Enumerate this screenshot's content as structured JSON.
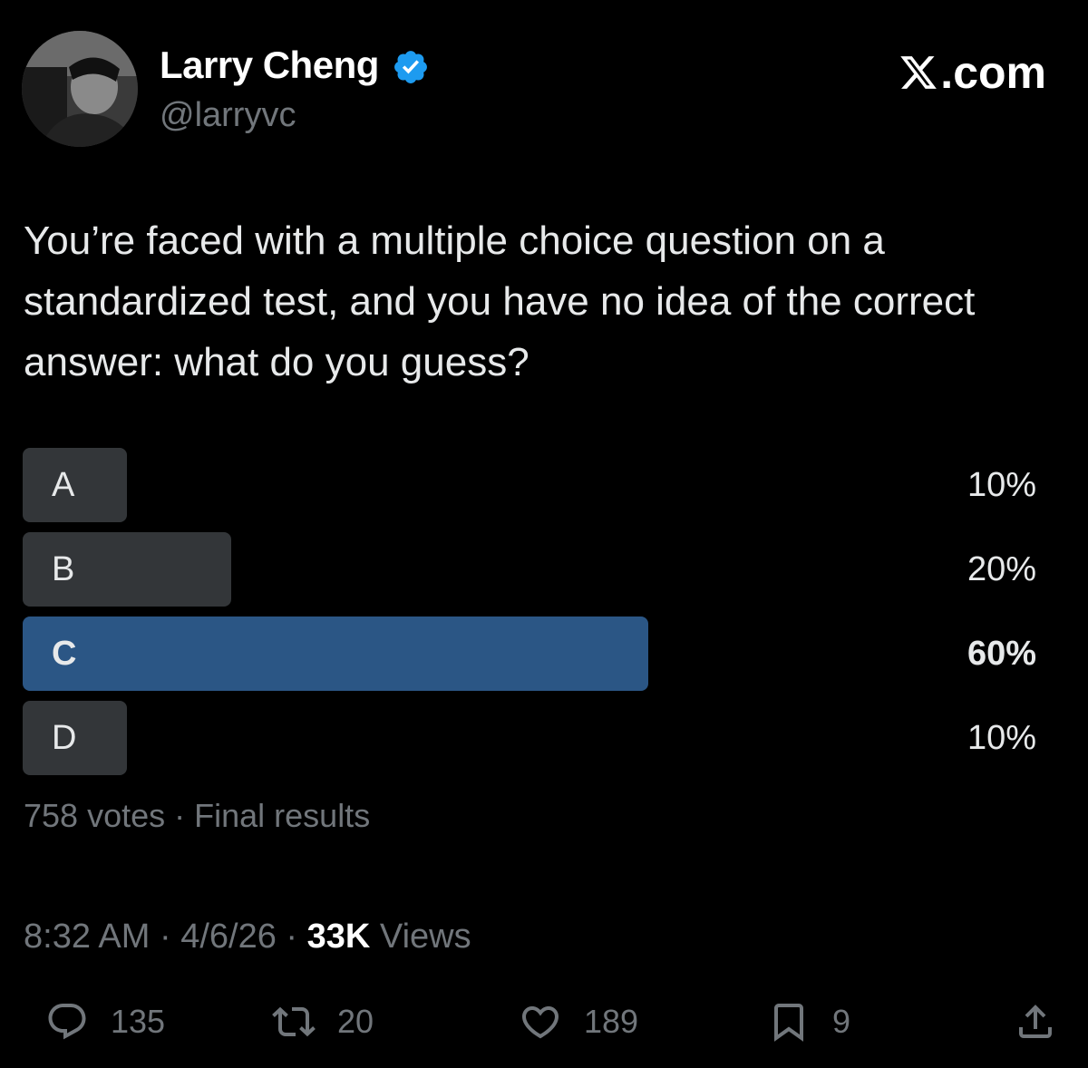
{
  "author": {
    "display_name": "Larry Cheng",
    "handle": "@larryvc",
    "verified": true
  },
  "brand": {
    "logo_icon": "x-logo-icon",
    "suffix": ".com"
  },
  "tweet": {
    "text": "You’re faced with a multiple choice question on a standardized test, and you have no idea of the correct answer: what do you guess?"
  },
  "poll": {
    "options": [
      {
        "label": "A",
        "percent": 10,
        "display": "10%",
        "winner": false
      },
      {
        "label": "B",
        "percent": 20,
        "display": "20%",
        "winner": false
      },
      {
        "label": "C",
        "percent": 60,
        "display": "60%",
        "winner": true
      },
      {
        "label": "D",
        "percent": 10,
        "display": "10%",
        "winner": false
      }
    ],
    "votes": "758 votes",
    "separator": " · ",
    "status": "Final results"
  },
  "meta": {
    "time": "8:32 AM",
    "date": "4/6/26",
    "views_count": "33K",
    "views_label": "Views",
    "separator": " · "
  },
  "actions": {
    "replies": "135",
    "reposts": "20",
    "likes": "189",
    "bookmarks": "9"
  },
  "colors": {
    "background": "#000000",
    "text": "#e7e9ea",
    "secondary": "#71767b",
    "verified_blue": "#1d9bf0",
    "poll_bar": "#333639",
    "poll_winner": "#2b5685"
  }
}
